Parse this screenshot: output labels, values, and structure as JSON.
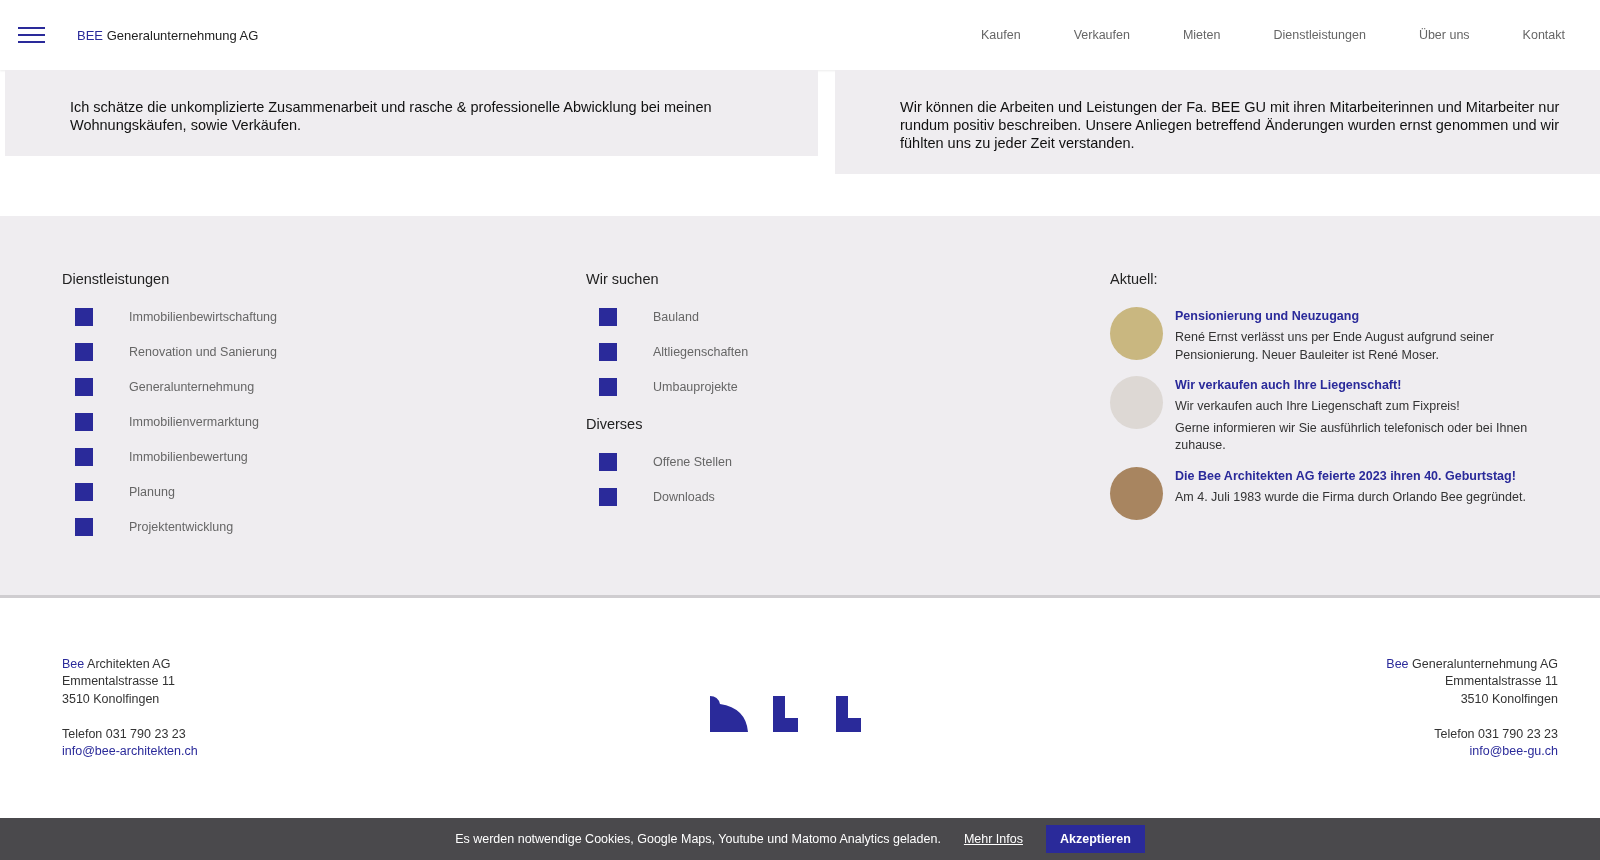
{
  "header": {
    "brand_mark": "BEE",
    "brand_name": "Generalunternehmung AG",
    "nav": [
      "Kaufen",
      "Verkaufen",
      "Mieten",
      "Dienstleistungen",
      "Über uns",
      "Kontakt"
    ]
  },
  "testimonials": [
    "Ich schätze die unkomplizierte Zusammenarbeit und rasche & professionelle Abwicklung bei meinen Wohnungskäufen, sowie Verkäufen.",
    "Wir können die Arbeiten und Leistungen der Fa. BEE GU mit ihren Mitarbeiterinnen und Mitarbeiter nur rundum positiv beschreiben. Unsere Anliegen betreffend Änderungen wurden ernst genommen und wir fühlten uns zu jeder Zeit verstanden."
  ],
  "footer_columns": [
    {
      "sections": [
        {
          "title": "Dienstleistungen",
          "items": [
            "Immobilienbewirtschaftung",
            "Renovation und Sanierung",
            "Generalunternehmung",
            "Immobilienvermarktung",
            "Immobilienbewertung",
            "Planung",
            "Projektentwicklung"
          ]
        }
      ]
    },
    {
      "sections": [
        {
          "title": "Wir suchen",
          "items": [
            "Bauland",
            "Altliegenschaften",
            "Umbauprojekte"
          ]
        },
        {
          "title": "Diverses",
          "items": [
            "Offene Stellen",
            "Downloads"
          ]
        }
      ]
    }
  ],
  "news": {
    "title": "Aktuell:",
    "items": [
      {
        "headline": "Pensionierung und Neuzugang",
        "paragraphs": [
          "René Ernst verlässt uns per Ende August aufgrund seiner Pensionierung. Neuer Bauleiter ist René Moser."
        ]
      },
      {
        "headline": "Wir verkaufen auch Ihre Liegenschaft!",
        "paragraphs": [
          "Wir verkaufen auch Ihre Liegenschaft zum Fixpreis!",
          "Gerne informieren wir Sie ausführlich telefonisch oder bei Ihnen zuhause."
        ]
      },
      {
        "headline": "Die Bee Architekten AG feierte 2023 ihren 40. Geburtstag!",
        "paragraphs": [
          "Am 4. Juli 1983 wurde die Firma durch Orlando Bee gegründet."
        ]
      }
    ]
  },
  "addresses": [
    {
      "brand": "Bee",
      "name": "Architekten AG",
      "street": "Emmentalstrasse 11",
      "city": "3510 Konolfingen",
      "phone": "Telefon 031 790 23 23",
      "email": "info@bee-architekten.ch"
    },
    {
      "brand": "Bee",
      "name": "Generalunternehmung AG",
      "street": "Emmentalstrasse 11",
      "city": "3510 Konolfingen",
      "phone": "Telefon 031 790 23 23",
      "email": "info@bee-gu.ch"
    }
  ],
  "cookie_bar": {
    "message": "Es werden notwendige Cookies, Google Maps, Youtube und Matomo Analytics geladen.",
    "link": "Mehr Infos",
    "button": "Akzeptieren"
  }
}
